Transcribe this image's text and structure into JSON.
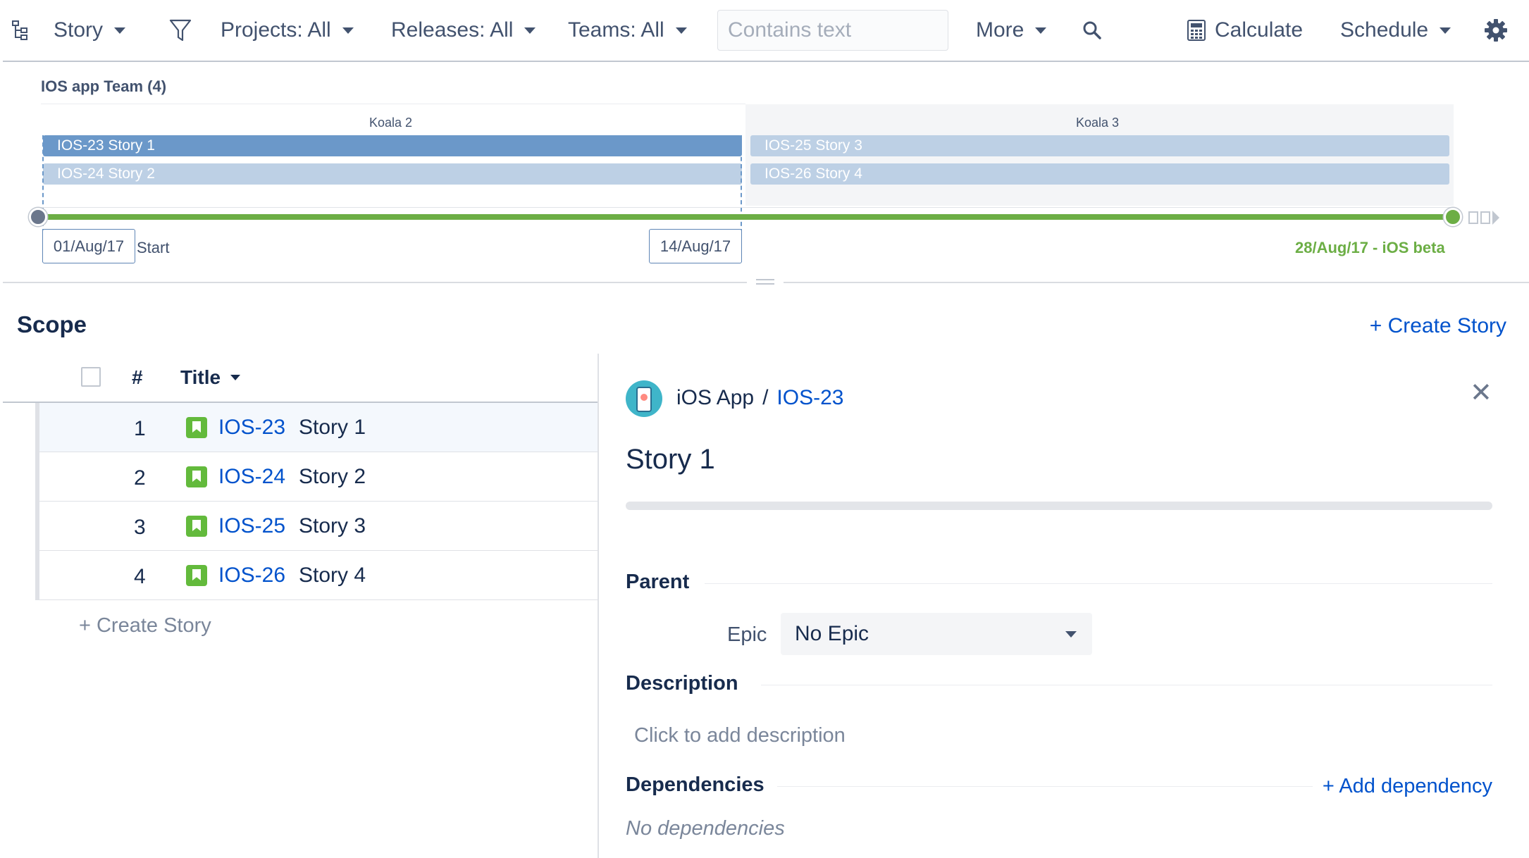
{
  "toolbar": {
    "hierarchy_label": "Story",
    "projects_label": "Projects: All",
    "releases_label": "Releases: All",
    "teams_label": "Teams: All",
    "search_placeholder": "Contains text",
    "more_label": "More",
    "calculate_label": "Calculate",
    "schedule_label": "Schedule"
  },
  "timeline": {
    "team_title": "IOS app Team (4)",
    "sprints": [
      {
        "name": "Koala 2"
      },
      {
        "name": "Koala 3"
      }
    ],
    "bars": [
      {
        "label": "IOS-23 Story 1",
        "state": "selected"
      },
      {
        "label": "IOS-24 Story 2",
        "state": "normal"
      },
      {
        "label": "IOS-25 Story 3",
        "state": "normal"
      },
      {
        "label": "IOS-26 Story 4",
        "state": "normal"
      }
    ],
    "start_date": "01/Aug/17",
    "start_label": "Start",
    "end_date": "14/Aug/17",
    "release_label": "28/Aug/17 - iOS beta"
  },
  "scope": {
    "title": "Scope",
    "create_story_label": "+ Create Story",
    "columns": {
      "num": "#",
      "title": "Title"
    },
    "rows": [
      {
        "num": "1",
        "key": "IOS-23",
        "summary": "Story 1"
      },
      {
        "num": "2",
        "key": "IOS-24",
        "summary": "Story 2"
      },
      {
        "num": "3",
        "key": "IOS-25",
        "summary": "Story 3"
      },
      {
        "num": "4",
        "key": "IOS-26",
        "summary": "Story 4"
      }
    ],
    "create_story_bottom": "+ Create Story"
  },
  "detail": {
    "project": "iOS App",
    "separator": "/",
    "issue_key": "IOS-23",
    "close_symbol": "✕",
    "title": "Story 1",
    "parent_heading": "Parent",
    "epic_label": "Epic",
    "epic_value": "No Epic",
    "description_heading": "Description",
    "description_placeholder": "Click to add description",
    "dependencies_heading": "Dependencies",
    "add_dependency_label": "+ Add dependency",
    "no_dependencies": "No dependencies"
  },
  "colors": {
    "link": "#0052cc",
    "bar_selected": "#6b98c9",
    "bar_normal": "#bdd0e5",
    "release_green": "#6cae45",
    "story_icon": "#63ba3c"
  }
}
